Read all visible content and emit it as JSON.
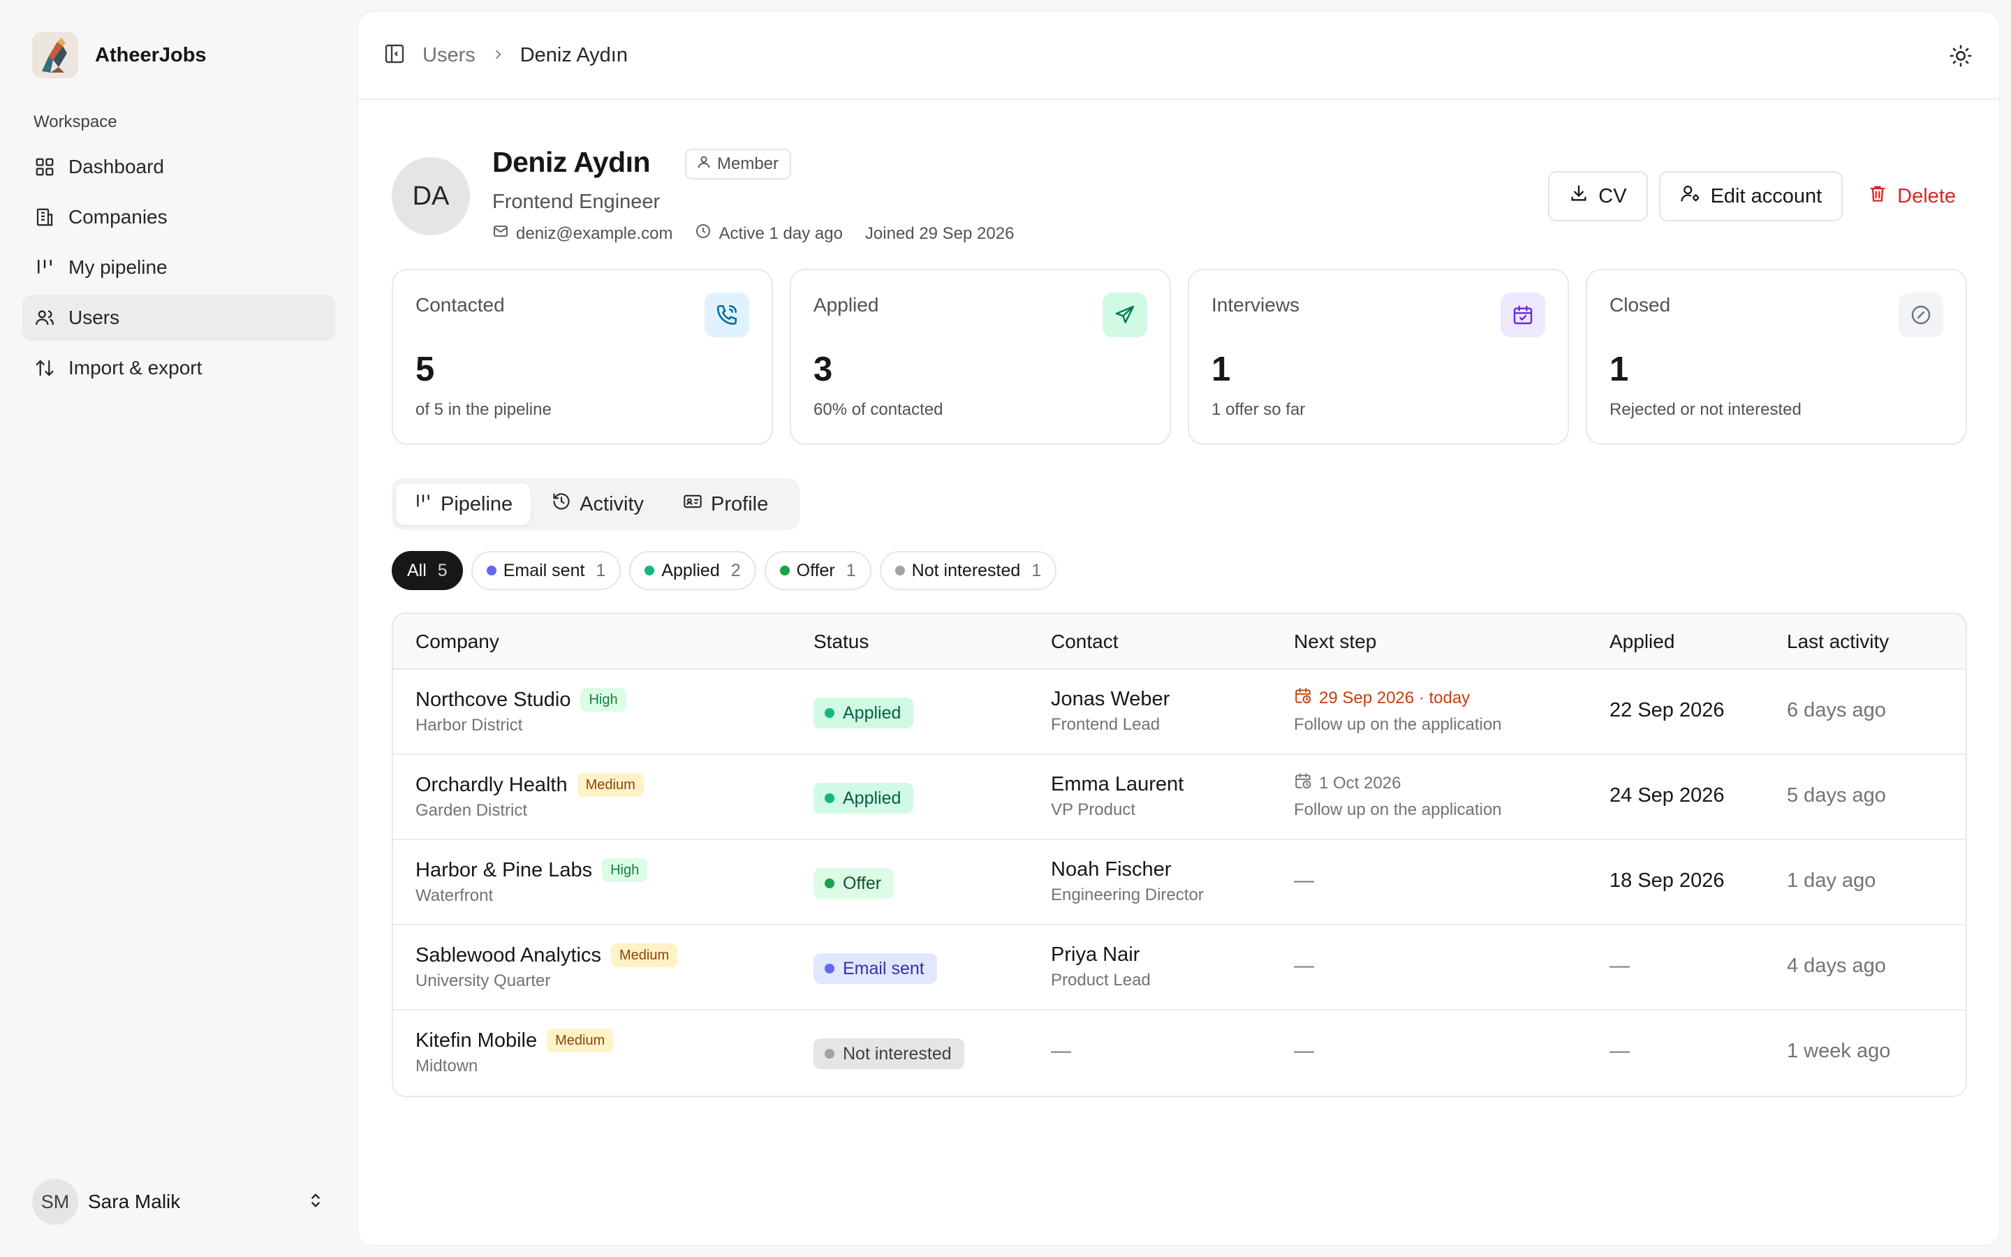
{
  "app": {
    "name": "AtheerJobs",
    "section_label": "Workspace"
  },
  "nav": [
    {
      "label": "Dashboard",
      "icon": "grid-icon",
      "active": false
    },
    {
      "label": "Companies",
      "icon": "building-icon",
      "active": false
    },
    {
      "label": "My pipeline",
      "icon": "pipeline-icon",
      "active": false
    },
    {
      "label": "Users",
      "icon": "users-icon",
      "active": true
    },
    {
      "label": "Import & export",
      "icon": "arrows-updown-icon",
      "active": false
    }
  ],
  "current_user": {
    "initials": "SM",
    "name": "Sara Malik"
  },
  "breadcrumb": {
    "parent": "Users",
    "current": "Deniz Aydın"
  },
  "profile": {
    "initials": "DA",
    "name": "Deniz Aydın",
    "role_badge": "Member",
    "title": "Frontend Engineer",
    "email": "deniz@example.com",
    "active": "Active 1 day ago",
    "joined": "Joined 29 Sep 2026"
  },
  "actions": {
    "cv": "CV",
    "edit": "Edit account",
    "delete": "Delete"
  },
  "stats": [
    {
      "label": "Contacted",
      "value": "5",
      "sub": "of 5 in the pipeline",
      "icon": "phone-icon",
      "bg": "#e0f2fe",
      "fg": "#0369a1"
    },
    {
      "label": "Applied",
      "value": "3",
      "sub": "60% of contacted",
      "icon": "send-icon",
      "bg": "#d1fae5",
      "fg": "#047857"
    },
    {
      "label": "Interviews",
      "value": "1",
      "sub": "1 offer so far",
      "icon": "calendar-check-icon",
      "bg": "#ede9fe",
      "fg": "#6d28d9"
    },
    {
      "label": "Closed",
      "value": "1",
      "sub": "Rejected or not interested",
      "icon": "circle-slash-icon",
      "bg": "#f3f4f6",
      "fg": "#6b7280"
    }
  ],
  "tabs": [
    {
      "label": "Pipeline",
      "active": true
    },
    {
      "label": "Activity",
      "active": false
    },
    {
      "label": "Profile",
      "active": false
    }
  ],
  "filters": [
    {
      "label": "All",
      "count": "5",
      "active": true,
      "dot": ""
    },
    {
      "label": "Email sent",
      "count": "1",
      "active": false,
      "dot": "#6366f1"
    },
    {
      "label": "Applied",
      "count": "2",
      "active": false,
      "dot": "#10b981"
    },
    {
      "label": "Offer",
      "count": "1",
      "active": false,
      "dot": "#16a34a"
    },
    {
      "label": "Not interested",
      "count": "1",
      "active": false,
      "dot": "#a3a3a3"
    }
  ],
  "table": {
    "headers": {
      "company": "Company",
      "status": "Status",
      "contact": "Contact",
      "next": "Next step",
      "applied": "Applied",
      "last": "Last activity"
    },
    "rows": [
      {
        "company": "Northcove Studio",
        "priority": "High",
        "area": "Harbor District",
        "status": "Applied",
        "status_kind": "applied",
        "contact": "Jonas Weber",
        "contact_role": "Frontend Lead",
        "next_date": "29 Sep 2026 · today",
        "next_kind": "today",
        "next_note": "Follow up on the application",
        "applied": "22 Sep 2026",
        "last": "6 days ago"
      },
      {
        "company": "Orchardly Health",
        "priority": "Medium",
        "area": "Garden District",
        "status": "Applied",
        "status_kind": "applied",
        "contact": "Emma Laurent",
        "contact_role": "VP Product",
        "next_date": "1 Oct 2026",
        "next_kind": "future",
        "next_note": "Follow up on the application",
        "applied": "24 Sep 2026",
        "last": "5 days ago"
      },
      {
        "company": "Harbor & Pine Labs",
        "priority": "High",
        "area": "Waterfront",
        "status": "Offer",
        "status_kind": "offer",
        "contact": "Noah Fischer",
        "contact_role": "Engineering Director",
        "next_date": "",
        "next_kind": "none",
        "next_note": "",
        "applied": "18 Sep 2026",
        "last": "1 day ago"
      },
      {
        "company": "Sablewood Analytics",
        "priority": "Medium",
        "area": "University Quarter",
        "status": "Email sent",
        "status_kind": "email",
        "contact": "Priya Nair",
        "contact_role": "Product Lead",
        "next_date": "",
        "next_kind": "none",
        "next_note": "",
        "applied": "—",
        "last": "4 days ago"
      },
      {
        "company": "Kitefin Mobile",
        "priority": "Medium",
        "area": "Midtown",
        "status": "Not interested",
        "status_kind": "not",
        "contact": "—",
        "contact_role": "",
        "next_date": "",
        "next_kind": "none",
        "next_note": "",
        "applied": "—",
        "last": "1 week ago"
      }
    ],
    "empty": "—"
  }
}
